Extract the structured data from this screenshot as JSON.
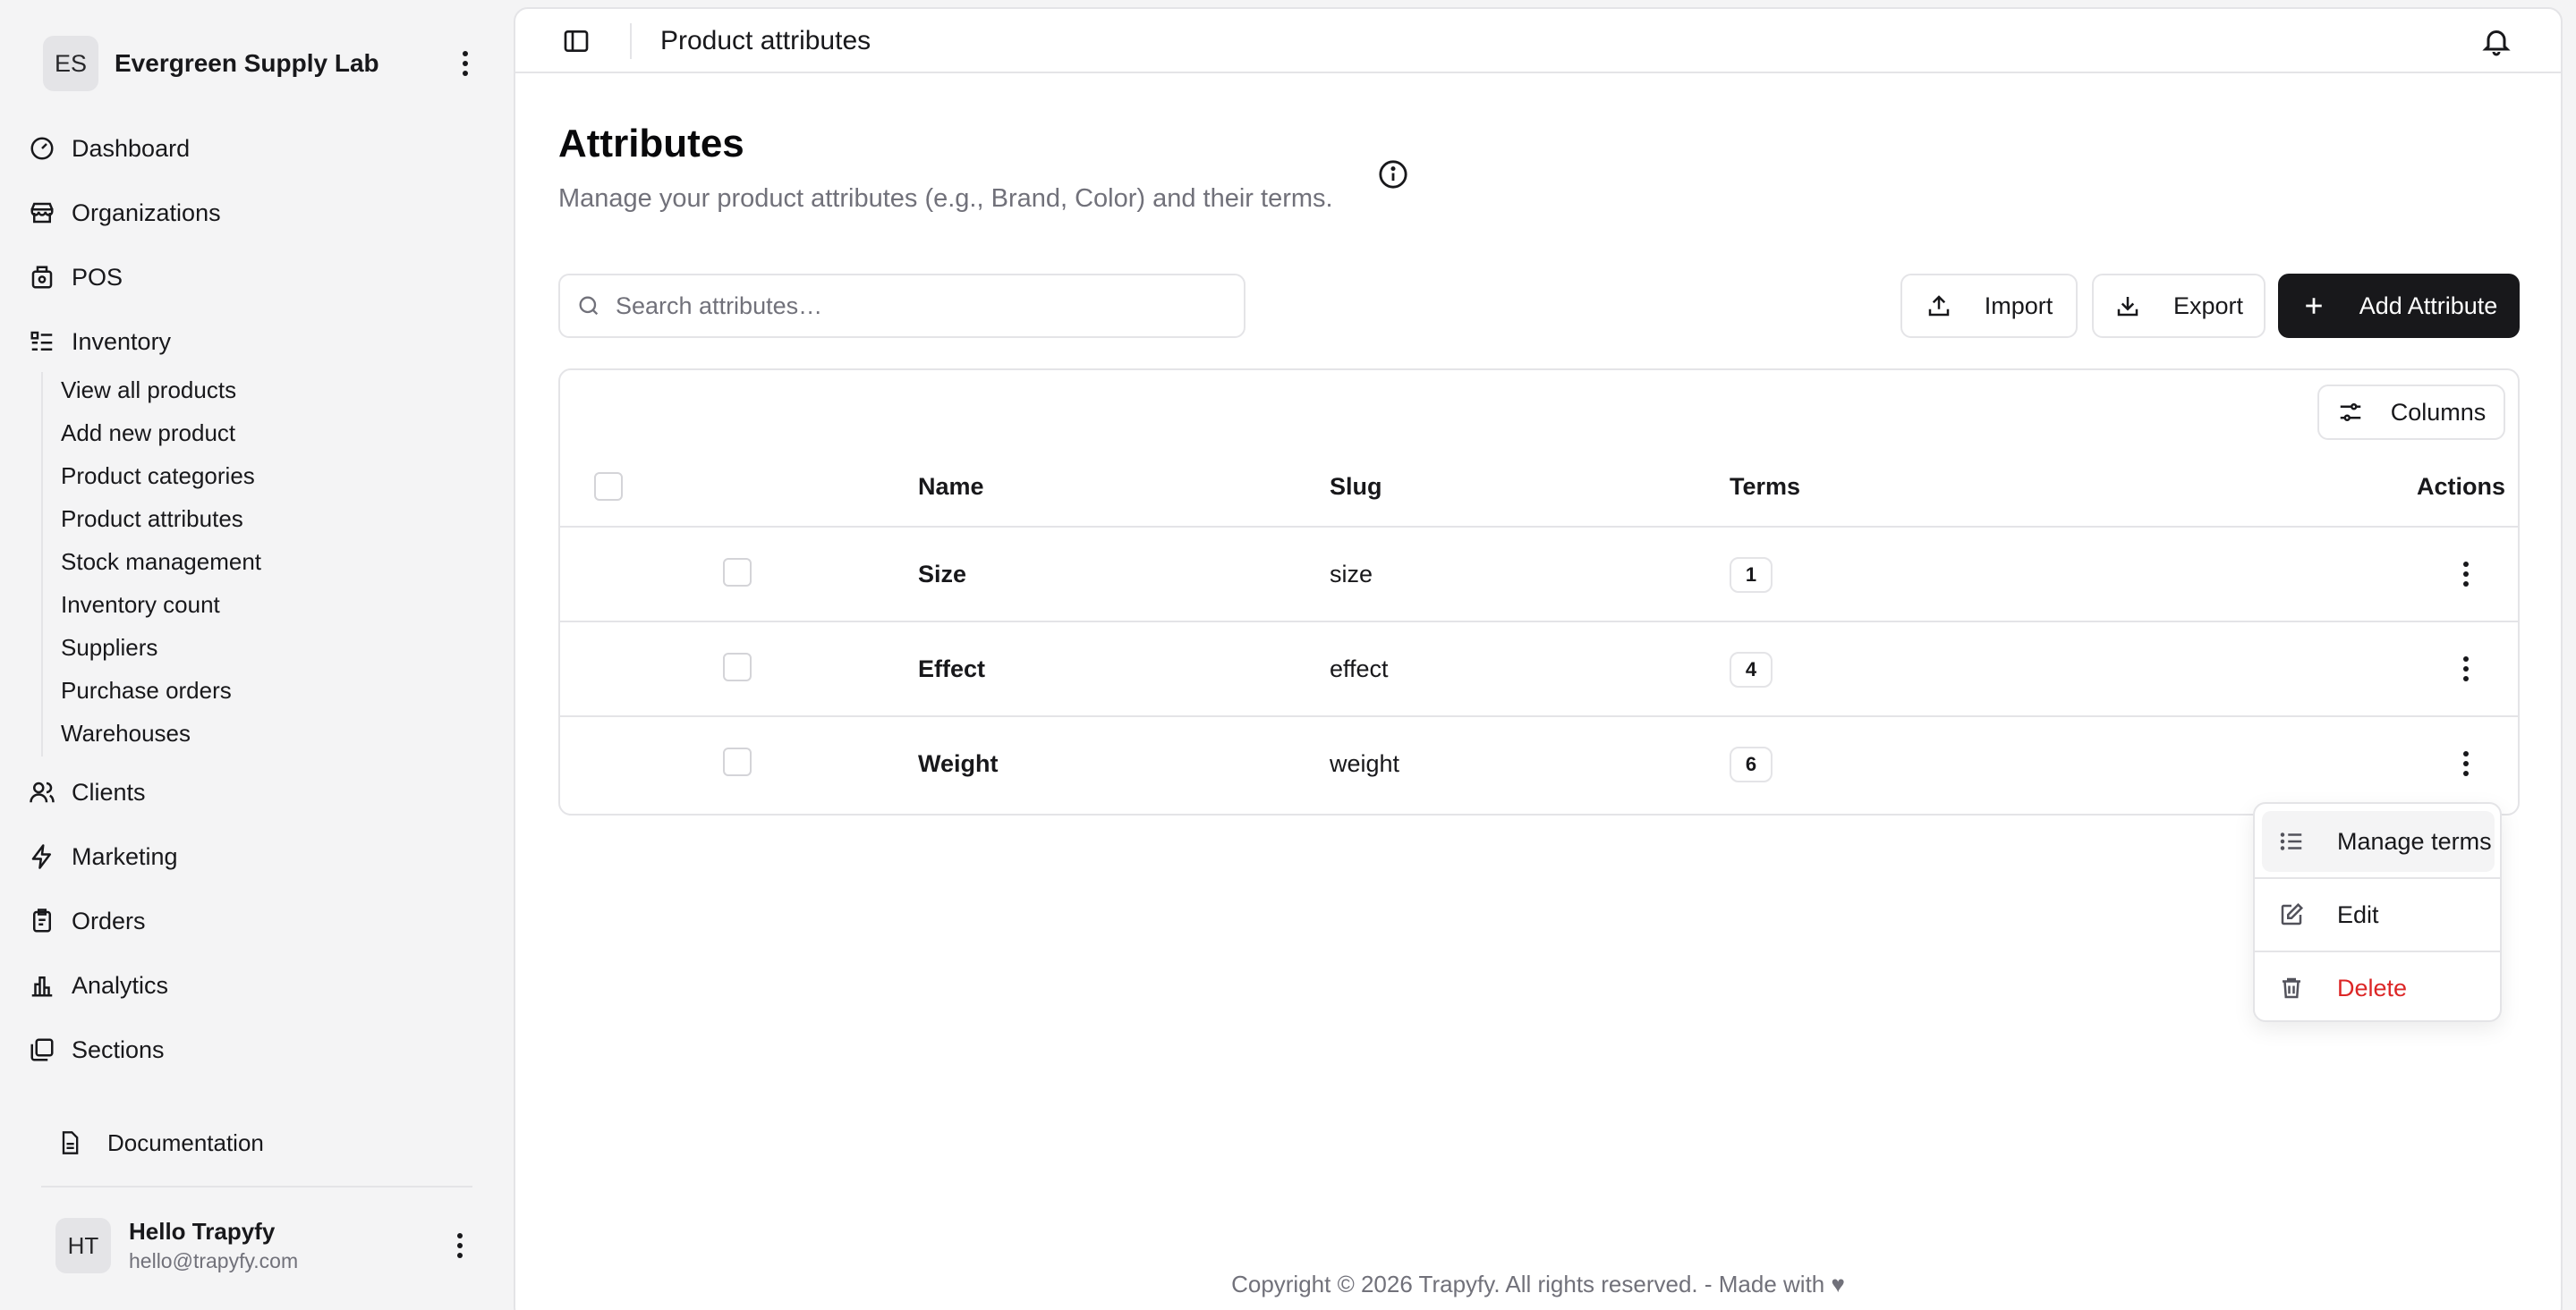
{
  "org": {
    "initials": "ES",
    "name": "Evergreen Supply Lab"
  },
  "nav": {
    "dashboard": "Dashboard",
    "organizations": "Organizations",
    "pos": "POS",
    "inventory": "Inventory",
    "inventory_items": [
      "View all products",
      "Add new product",
      "Product categories",
      "Product attributes",
      "Stock management",
      "Inventory count",
      "Suppliers",
      "Purchase orders",
      "Warehouses"
    ],
    "clients": "Clients",
    "marketing": "Marketing",
    "orders": "Orders",
    "analytics": "Analytics",
    "sections": "Sections",
    "documentation": "Documentation"
  },
  "user": {
    "initials": "HT",
    "name": "Hello Trapyfy",
    "email": "hello@trapyfy.com"
  },
  "topbar": {
    "title": "Product attributes"
  },
  "page": {
    "title": "Attributes",
    "subtitle": "Manage your product attributes (e.g., Brand, Color) and their terms."
  },
  "search": {
    "placeholder": "Search attributes…",
    "value": ""
  },
  "toolbar": {
    "import_label": "Import",
    "export_label": "Export",
    "add_label": "Add Attribute"
  },
  "table": {
    "columns_label": "Columns",
    "headers": {
      "name": "Name",
      "slug": "Slug",
      "terms": "Terms",
      "actions": "Actions"
    },
    "rows": [
      {
        "name": "Size",
        "slug": "size",
        "terms": "1"
      },
      {
        "name": "Effect",
        "slug": "effect",
        "terms": "4"
      },
      {
        "name": "Weight",
        "slug": "weight",
        "terms": "6"
      }
    ]
  },
  "menu": {
    "manage_terms": "Manage terms",
    "edit": "Edit",
    "delete": "Delete"
  },
  "footer": {
    "text": "Copyright © 2026 Trapyfy. All rights reserved. - Made with ♥"
  },
  "colors": {
    "primary": "#18181b",
    "danger": "#dc2626",
    "muted": "#71717a",
    "border": "#e4e4e7"
  }
}
